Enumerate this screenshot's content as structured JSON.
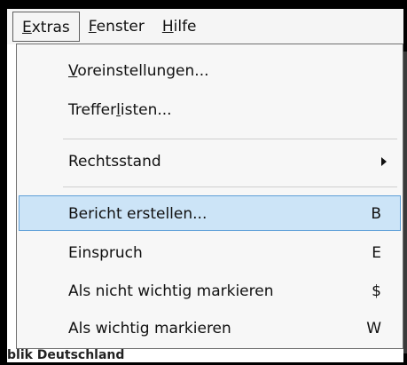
{
  "menubar": {
    "items": [
      {
        "prefix": "",
        "u": "E",
        "suffix": "xtras",
        "open": true
      },
      {
        "prefix": "",
        "u": "F",
        "suffix": "enster",
        "open": false
      },
      {
        "prefix": "",
        "u": "H",
        "suffix": "ilfe",
        "open": false
      }
    ]
  },
  "menu": {
    "items": [
      {
        "u": "V",
        "rest": "oreinstellungen...",
        "accel": ""
      },
      {
        "pre": "Treffer",
        "u": "l",
        "rest": "isten...",
        "accel": ""
      },
      {
        "label": "Rechtsstand",
        "accel": "",
        "submenu": true
      },
      {
        "label": "Bericht erstellen...",
        "accel": "B",
        "highlighted": true
      },
      {
        "label": "Einspruch",
        "accel": "E"
      },
      {
        "label": "Als nicht wichtig markieren",
        "accel": "$"
      },
      {
        "label": "Als wichtig markieren",
        "accel": "W"
      }
    ]
  },
  "background": {
    "partial_text": "blik Deutschland"
  }
}
